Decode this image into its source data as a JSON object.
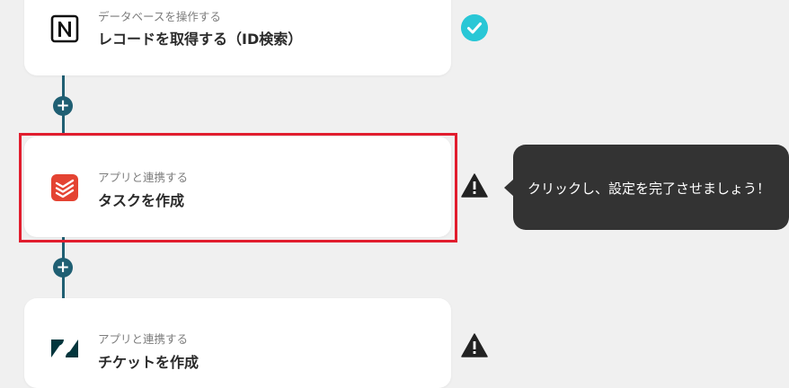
{
  "steps": [
    {
      "subtitle": "データベースを操作する",
      "title": "レコードを取得する（ID検索）",
      "app_icon": "notion-icon",
      "status": "complete",
      "status_icon": "check-circle-icon"
    },
    {
      "subtitle": "アプリと連携する",
      "title": "タスクを作成",
      "app_icon": "todoist-icon",
      "status": "warning",
      "status_icon": "warning-icon"
    },
    {
      "subtitle": "アプリと連携する",
      "title": "チケットを作成",
      "app_icon": "zendesk-icon",
      "status": "warning",
      "status_icon": "warning-icon"
    }
  ],
  "tooltip": {
    "text": "クリックし、設定を完了させましょう！"
  },
  "colors": {
    "connector": "#1f5f73",
    "highlight": "#e11d2e",
    "check": "#29c7d6",
    "todoist": "#e44332",
    "zendesk": "#03363d",
    "tooltip_bg": "#333333"
  }
}
